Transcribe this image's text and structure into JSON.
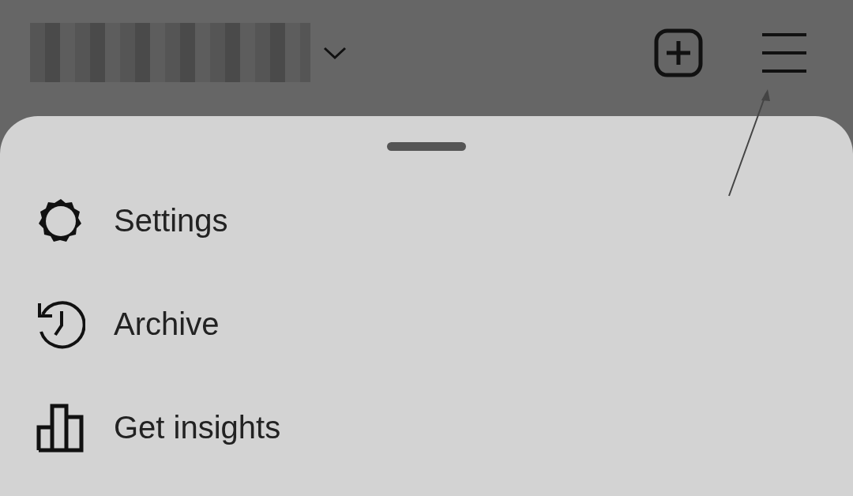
{
  "menu_items": [
    {
      "kind": "settings",
      "label": "Settings"
    },
    {
      "kind": "archive",
      "label": "Archive"
    },
    {
      "kind": "insights",
      "label": "Get insights"
    }
  ]
}
